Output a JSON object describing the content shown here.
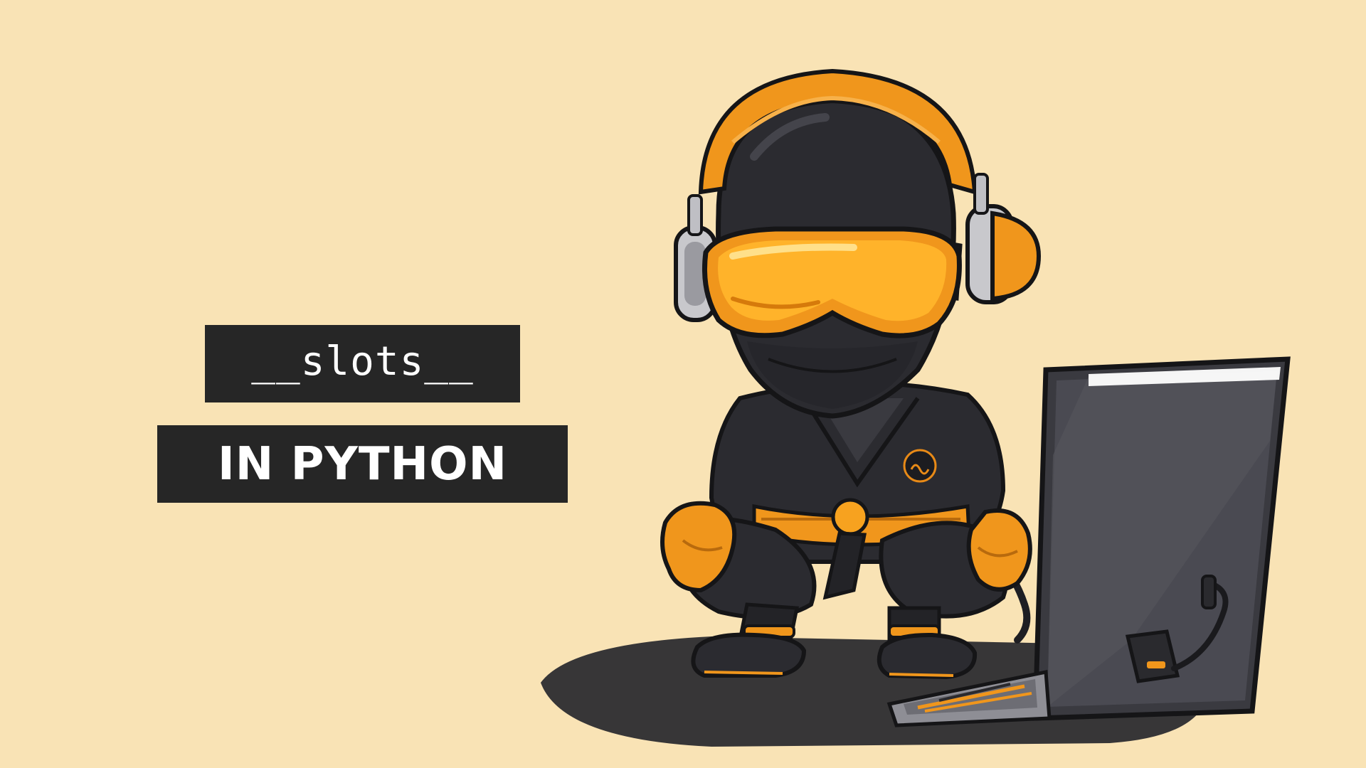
{
  "title": {
    "line1": "__slots__",
    "line2": "IN PYTHON"
  },
  "colors": {
    "background": "#f9e3b5",
    "label_box": "#262626",
    "label_text": "#ffffff",
    "accent_orange": "#f0961c",
    "ninja_black": "#2a2a2e"
  },
  "illustration": {
    "subject": "ninja-with-headphones-and-laptop-icon"
  }
}
